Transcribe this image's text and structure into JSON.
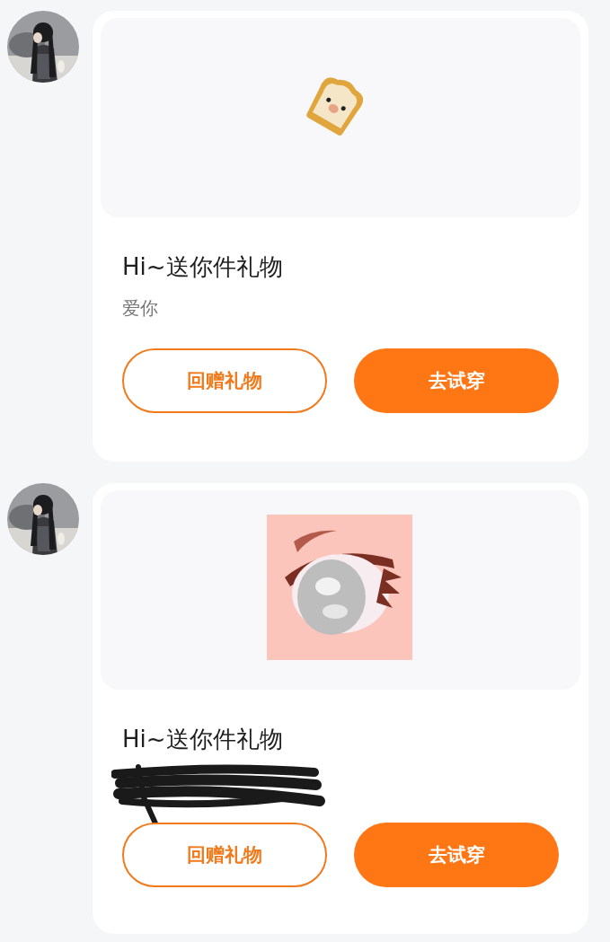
{
  "messages": [
    {
      "gift": {
        "kind": "sticker"
      },
      "title": "Hi~送你件礼物",
      "note": {
        "kind": "text",
        "text": "爱你"
      },
      "buttons": [
        {
          "label": "回赠礼物",
          "kind": "outline"
        },
        {
          "label": "去试穿",
          "kind": "filled"
        }
      ]
    },
    {
      "title": "Hi~送你件礼物",
      "note": {
        "kind": "redacted"
      },
      "buttons": [
        {
          "label": "回赠礼物",
          "kind": "outline"
        },
        {
          "label": "去试穿",
          "kind": "filled"
        }
      ]
    }
  ]
}
